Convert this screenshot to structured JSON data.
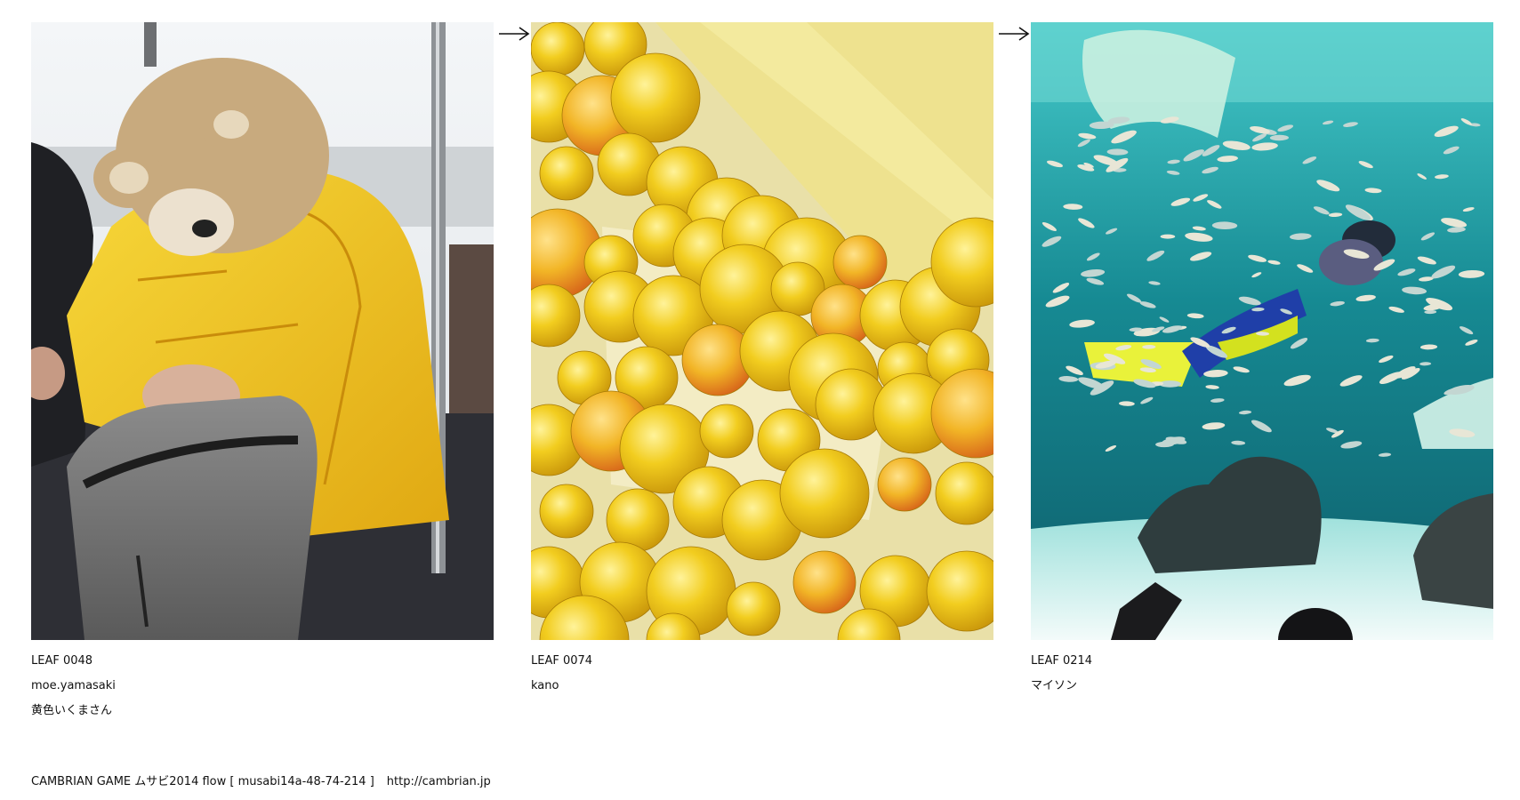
{
  "leaves": [
    {
      "id": "LEAF 0048",
      "author": "moe.yamasaki",
      "caption": "黄色いくまさん",
      "image": "photo-bear-costume-train"
    },
    {
      "id": "LEAF 0074",
      "author": "kano",
      "caption": "",
      "image": "photo-yellow-plums"
    },
    {
      "id": "LEAF 0214",
      "author": "マイソン",
      "caption": "",
      "image": "photo-aquarium-diver"
    }
  ],
  "arrows": [
    "arrow-right-icon",
    "arrow-right-icon"
  ],
  "footer": {
    "text": "CAMBRIAN GAME  ムサビ2014  flow [ musabi14a-48-74-214 ]",
    "link": "http://cambrian.jp"
  },
  "colors": {
    "background": "#ffffff",
    "text": "#111111",
    "jacket": "#f2c51c",
    "plum": "#f0c020",
    "water": "#1fa8a8"
  }
}
